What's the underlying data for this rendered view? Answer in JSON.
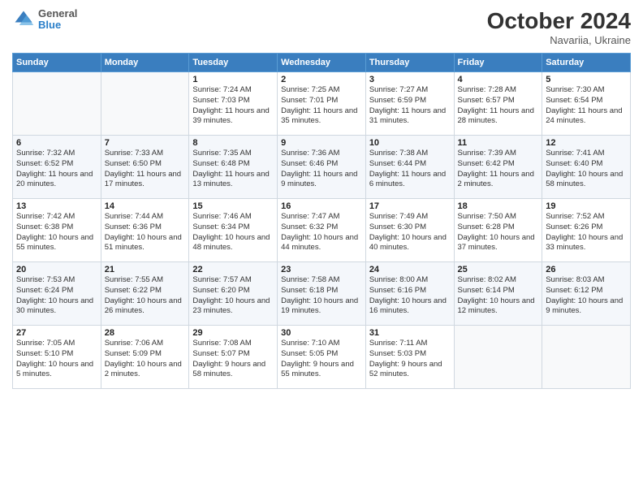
{
  "header": {
    "logo": {
      "general": "General",
      "blue": "Blue"
    },
    "title": "October 2024",
    "location": "Navariia, Ukraine"
  },
  "weekdays": [
    "Sunday",
    "Monday",
    "Tuesday",
    "Wednesday",
    "Thursday",
    "Friday",
    "Saturday"
  ],
  "weeks": [
    [
      {
        "day": "",
        "sunrise": "",
        "sunset": "",
        "daylight": ""
      },
      {
        "day": "",
        "sunrise": "",
        "sunset": "",
        "daylight": ""
      },
      {
        "day": "1",
        "sunrise": "Sunrise: 7:24 AM",
        "sunset": "Sunset: 7:03 PM",
        "daylight": "Daylight: 11 hours and 39 minutes."
      },
      {
        "day": "2",
        "sunrise": "Sunrise: 7:25 AM",
        "sunset": "Sunset: 7:01 PM",
        "daylight": "Daylight: 11 hours and 35 minutes."
      },
      {
        "day": "3",
        "sunrise": "Sunrise: 7:27 AM",
        "sunset": "Sunset: 6:59 PM",
        "daylight": "Daylight: 11 hours and 31 minutes."
      },
      {
        "day": "4",
        "sunrise": "Sunrise: 7:28 AM",
        "sunset": "Sunset: 6:57 PM",
        "daylight": "Daylight: 11 hours and 28 minutes."
      },
      {
        "day": "5",
        "sunrise": "Sunrise: 7:30 AM",
        "sunset": "Sunset: 6:54 PM",
        "daylight": "Daylight: 11 hours and 24 minutes."
      }
    ],
    [
      {
        "day": "6",
        "sunrise": "Sunrise: 7:32 AM",
        "sunset": "Sunset: 6:52 PM",
        "daylight": "Daylight: 11 hours and 20 minutes."
      },
      {
        "day": "7",
        "sunrise": "Sunrise: 7:33 AM",
        "sunset": "Sunset: 6:50 PM",
        "daylight": "Daylight: 11 hours and 17 minutes."
      },
      {
        "day": "8",
        "sunrise": "Sunrise: 7:35 AM",
        "sunset": "Sunset: 6:48 PM",
        "daylight": "Daylight: 11 hours and 13 minutes."
      },
      {
        "day": "9",
        "sunrise": "Sunrise: 7:36 AM",
        "sunset": "Sunset: 6:46 PM",
        "daylight": "Daylight: 11 hours and 9 minutes."
      },
      {
        "day": "10",
        "sunrise": "Sunrise: 7:38 AM",
        "sunset": "Sunset: 6:44 PM",
        "daylight": "Daylight: 11 hours and 6 minutes."
      },
      {
        "day": "11",
        "sunrise": "Sunrise: 7:39 AM",
        "sunset": "Sunset: 6:42 PM",
        "daylight": "Daylight: 11 hours and 2 minutes."
      },
      {
        "day": "12",
        "sunrise": "Sunrise: 7:41 AM",
        "sunset": "Sunset: 6:40 PM",
        "daylight": "Daylight: 10 hours and 58 minutes."
      }
    ],
    [
      {
        "day": "13",
        "sunrise": "Sunrise: 7:42 AM",
        "sunset": "Sunset: 6:38 PM",
        "daylight": "Daylight: 10 hours and 55 minutes."
      },
      {
        "day": "14",
        "sunrise": "Sunrise: 7:44 AM",
        "sunset": "Sunset: 6:36 PM",
        "daylight": "Daylight: 10 hours and 51 minutes."
      },
      {
        "day": "15",
        "sunrise": "Sunrise: 7:46 AM",
        "sunset": "Sunset: 6:34 PM",
        "daylight": "Daylight: 10 hours and 48 minutes."
      },
      {
        "day": "16",
        "sunrise": "Sunrise: 7:47 AM",
        "sunset": "Sunset: 6:32 PM",
        "daylight": "Daylight: 10 hours and 44 minutes."
      },
      {
        "day": "17",
        "sunrise": "Sunrise: 7:49 AM",
        "sunset": "Sunset: 6:30 PM",
        "daylight": "Daylight: 10 hours and 40 minutes."
      },
      {
        "day": "18",
        "sunrise": "Sunrise: 7:50 AM",
        "sunset": "Sunset: 6:28 PM",
        "daylight": "Daylight: 10 hours and 37 minutes."
      },
      {
        "day": "19",
        "sunrise": "Sunrise: 7:52 AM",
        "sunset": "Sunset: 6:26 PM",
        "daylight": "Daylight: 10 hours and 33 minutes."
      }
    ],
    [
      {
        "day": "20",
        "sunrise": "Sunrise: 7:53 AM",
        "sunset": "Sunset: 6:24 PM",
        "daylight": "Daylight: 10 hours and 30 minutes."
      },
      {
        "day": "21",
        "sunrise": "Sunrise: 7:55 AM",
        "sunset": "Sunset: 6:22 PM",
        "daylight": "Daylight: 10 hours and 26 minutes."
      },
      {
        "day": "22",
        "sunrise": "Sunrise: 7:57 AM",
        "sunset": "Sunset: 6:20 PM",
        "daylight": "Daylight: 10 hours and 23 minutes."
      },
      {
        "day": "23",
        "sunrise": "Sunrise: 7:58 AM",
        "sunset": "Sunset: 6:18 PM",
        "daylight": "Daylight: 10 hours and 19 minutes."
      },
      {
        "day": "24",
        "sunrise": "Sunrise: 8:00 AM",
        "sunset": "Sunset: 6:16 PM",
        "daylight": "Daylight: 10 hours and 16 minutes."
      },
      {
        "day": "25",
        "sunrise": "Sunrise: 8:02 AM",
        "sunset": "Sunset: 6:14 PM",
        "daylight": "Daylight: 10 hours and 12 minutes."
      },
      {
        "day": "26",
        "sunrise": "Sunrise: 8:03 AM",
        "sunset": "Sunset: 6:12 PM",
        "daylight": "Daylight: 10 hours and 9 minutes."
      }
    ],
    [
      {
        "day": "27",
        "sunrise": "Sunrise: 7:05 AM",
        "sunset": "Sunset: 5:10 PM",
        "daylight": "Daylight: 10 hours and 5 minutes."
      },
      {
        "day": "28",
        "sunrise": "Sunrise: 7:06 AM",
        "sunset": "Sunset: 5:09 PM",
        "daylight": "Daylight: 10 hours and 2 minutes."
      },
      {
        "day": "29",
        "sunrise": "Sunrise: 7:08 AM",
        "sunset": "Sunset: 5:07 PM",
        "daylight": "Daylight: 9 hours and 58 minutes."
      },
      {
        "day": "30",
        "sunrise": "Sunrise: 7:10 AM",
        "sunset": "Sunset: 5:05 PM",
        "daylight": "Daylight: 9 hours and 55 minutes."
      },
      {
        "day": "31",
        "sunrise": "Sunrise: 7:11 AM",
        "sunset": "Sunset: 5:03 PM",
        "daylight": "Daylight: 9 hours and 52 minutes."
      },
      {
        "day": "",
        "sunrise": "",
        "sunset": "",
        "daylight": ""
      },
      {
        "day": "",
        "sunrise": "",
        "sunset": "",
        "daylight": ""
      }
    ]
  ]
}
